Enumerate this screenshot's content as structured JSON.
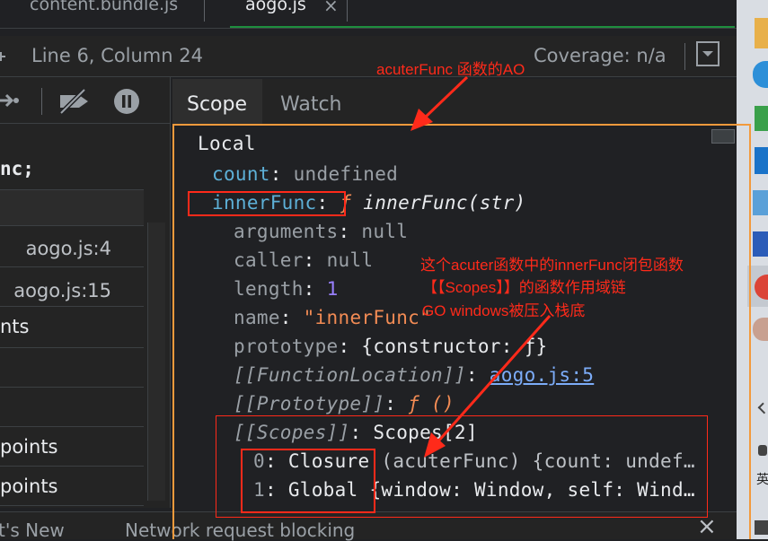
{
  "tabs": [
    "content.bundle.js",
    "aogo.js"
  ],
  "tab_close": "×",
  "status": {
    "position": "Line 6, Column 24",
    "coverage": "Coverage: n/a"
  },
  "left_pane": {
    "code_fragment": "nc;",
    "callstack": [
      {
        "location": "aogo.js:4"
      },
      {
        "location": "aogo.js:15"
      }
    ],
    "sections": [
      "nts",
      "points",
      "points"
    ]
  },
  "scope_tabs": [
    "Scope",
    "Watch"
  ],
  "scope": {
    "local_label": "Local",
    "count": {
      "name": "count",
      "value": "undefined"
    },
    "innerFunc": {
      "name": "innerFunc",
      "f": "ƒ",
      "sig": "innerFunc(str)"
    },
    "arguments": {
      "name": "arguments",
      "value": "null"
    },
    "caller": {
      "name": "caller",
      "value": "null"
    },
    "length": {
      "name": "length",
      "value": "1"
    },
    "fname": {
      "name": "name",
      "value": "\"innerFunc\""
    },
    "prototype": {
      "name": "prototype",
      "value": "{constructor: ƒ}"
    },
    "function_location": {
      "name": "[[FunctionLocation]]",
      "value": "aogo.js:5"
    },
    "proto": {
      "name": "[[Prototype]]",
      "value": "ƒ ()"
    },
    "scopes": {
      "name": "[[Scopes]]",
      "value": "Scopes[2]"
    },
    "closure": {
      "index": "0",
      "label": "Closure",
      "rest": "(acuterFunc) {count: undef…"
    },
    "global": {
      "index": "1",
      "label": "Global",
      "rest": "{window: Window, self: Wind…"
    }
  },
  "drawer": {
    "tabs": [
      "t's New",
      "Network request blocking"
    ],
    "close": "×"
  },
  "annotations": {
    "top": "acuterFunc 函数的AO",
    "line1": "这个acuter函数中的innerFunc闭包函数",
    "line2": "【【Scopes】】的函数作用域链",
    "line3": "GO windows被压入栈底"
  },
  "taskbar": {
    "ime_label": "英"
  },
  "colors": {
    "accent_orange": "#f39a3c",
    "annotation_red": "#ff2a1a",
    "tab_underline": "#1e8e3e"
  }
}
